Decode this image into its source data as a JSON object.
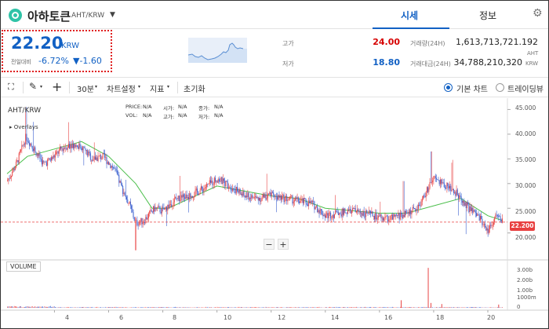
{
  "header": {
    "coin_name": "아하토큰",
    "pair": "AHT/KRW",
    "caret": "▼",
    "tabs": [
      {
        "label": "시세",
        "active": true
      },
      {
        "label": "정보",
        "active": false
      }
    ],
    "settings_icon": "gear-icon"
  },
  "price": {
    "value": "22.20",
    "unit": "KRW",
    "change_label": "전일대비",
    "change_pct": "-6.72%",
    "change_value": "▼-1.60"
  },
  "stats": {
    "high_label": "고가",
    "high": "24.00",
    "low_label": "저가",
    "low": "18.80",
    "volume_label": "거래량(24H)",
    "volume": "1,613,713,721.192",
    "volume_unit": "AHT",
    "amount_label": "거래대금(24H)",
    "amount": "34,788,210,320",
    "amount_unit": "KRW"
  },
  "toolbar": {
    "interval": "30분",
    "chart_settings": "차트설정",
    "indicators": "지표",
    "reset": "초기화",
    "basic_chart": "기본 차트",
    "trading_view": "트레이딩뷰"
  },
  "chart": {
    "pair": "AHT/KRW",
    "overlays": "Overlays",
    "info": {
      "price_label": "PRICE:",
      "price_val": "N/A",
      "open_label": "시가:",
      "open_val": "N/A",
      "close_label": "종가:",
      "close_val": "N/A",
      "vol_label": "VOL:",
      "vol_val": "N/A",
      "high_label": "고가:",
      "high_val": "N/A",
      "low_label": "저가:",
      "low_val": "N/A"
    },
    "volume_label": "VOLUME",
    "current_price_tag": "22.200",
    "zoom_out": "−",
    "zoom_in": "+"
  },
  "chart_data": {
    "type": "candlestick",
    "y_ticks": [
      "45.000",
      "40.000",
      "35.000",
      "30.000",
      "25.000",
      "20.000"
    ],
    "y_tick_values": [
      45,
      40,
      35,
      30,
      25,
      20
    ],
    "ylim": [
      15.5,
      46.5
    ],
    "volume_ticks": [
      "3.00b",
      "2.00b",
      "1.00b",
      "1000m",
      "0"
    ],
    "x_ticks": [
      "4",
      "6",
      "8",
      "10",
      "12",
      "14",
      "16",
      "18",
      "20"
    ],
    "x_tick_days": [
      4,
      6,
      8,
      10,
      12,
      14,
      16,
      18,
      20
    ],
    "xlim_days": [
      2.25,
      20.55
    ],
    "price_path": [
      {
        "day": 2.25,
        "price": 30.5
      },
      {
        "day": 2.6,
        "price": 34
      },
      {
        "day": 2.95,
        "price": 39.5
      },
      {
        "day": 3.25,
        "price": 37
      },
      {
        "day": 3.6,
        "price": 34
      },
      {
        "day": 3.9,
        "price": 35
      },
      {
        "day": 4.25,
        "price": 37
      },
      {
        "day": 4.6,
        "price": 38
      },
      {
        "day": 5.0,
        "price": 37.5
      },
      {
        "day": 5.4,
        "price": 35
      },
      {
        "day": 5.8,
        "price": 35.5
      },
      {
        "day": 6.2,
        "price": 33
      },
      {
        "day": 6.5,
        "price": 29
      },
      {
        "day": 6.75,
        "price": 26
      },
      {
        "day": 7.0,
        "price": 22
      },
      {
        "day": 7.3,
        "price": 22.5
      },
      {
        "day": 7.7,
        "price": 25
      },
      {
        "day": 8.0,
        "price": 24.5
      },
      {
        "day": 8.5,
        "price": 27
      },
      {
        "day": 9.0,
        "price": 27.5
      },
      {
        "day": 9.5,
        "price": 29
      },
      {
        "day": 10.0,
        "price": 31
      },
      {
        "day": 10.5,
        "price": 29.5
      },
      {
        "day": 11.0,
        "price": 27.5
      },
      {
        "day": 11.5,
        "price": 27
      },
      {
        "day": 12.0,
        "price": 27.5
      },
      {
        "day": 12.5,
        "price": 27
      },
      {
        "day": 13.0,
        "price": 26.5
      },
      {
        "day": 13.5,
        "price": 26
      },
      {
        "day": 14.0,
        "price": 23.5
      },
      {
        "day": 14.5,
        "price": 24
      },
      {
        "day": 15.0,
        "price": 24.5
      },
      {
        "day": 15.5,
        "price": 24
      },
      {
        "day": 16.0,
        "price": 23
      },
      {
        "day": 16.5,
        "price": 23
      },
      {
        "day": 17.0,
        "price": 24
      },
      {
        "day": 17.4,
        "price": 25
      },
      {
        "day": 17.7,
        "price": 28
      },
      {
        "day": 18.0,
        "price": 31
      },
      {
        "day": 18.3,
        "price": 30
      },
      {
        "day": 18.7,
        "price": 29
      },
      {
        "day": 19.0,
        "price": 27
      },
      {
        "day": 19.3,
        "price": 25
      },
      {
        "day": 19.7,
        "price": 23
      },
      {
        "day": 20.0,
        "price": 20.5
      },
      {
        "day": 20.3,
        "price": 23.5
      },
      {
        "day": 20.55,
        "price": 22.2
      }
    ],
    "ma_path": [
      {
        "day": 2.25,
        "price": 32
      },
      {
        "day": 3.0,
        "price": 35.5
      },
      {
        "day": 4.0,
        "price": 37
      },
      {
        "day": 5.0,
        "price": 38.5
      },
      {
        "day": 6.0,
        "price": 35.5
      },
      {
        "day": 7.0,
        "price": 30
      },
      {
        "day": 7.6,
        "price": 25
      },
      {
        "day": 8.2,
        "price": 25
      },
      {
        "day": 9.0,
        "price": 27
      },
      {
        "day": 10.0,
        "price": 29.5
      },
      {
        "day": 11.0,
        "price": 28.5
      },
      {
        "day": 12.0,
        "price": 27.5
      },
      {
        "day": 13.0,
        "price": 27
      },
      {
        "day": 14.0,
        "price": 25
      },
      {
        "day": 15.0,
        "price": 24.5
      },
      {
        "day": 16.0,
        "price": 24
      },
      {
        "day": 17.0,
        "price": 24
      },
      {
        "day": 18.0,
        "price": 25.5
      },
      {
        "day": 19.0,
        "price": 27
      },
      {
        "day": 20.0,
        "price": 23.5
      },
      {
        "day": 20.55,
        "price": 22.5
      }
    ],
    "volume_spikes_b": [
      {
        "day": 17.8,
        "volume": 3.7
      },
      {
        "day": 16.8,
        "volume": 0.7
      },
      {
        "day": 17.9,
        "volume": 0.45
      },
      {
        "day": 18.3,
        "volume": 0.35
      },
      {
        "day": 20.4,
        "volume": 0.3
      }
    ],
    "current_price": 22.2
  }
}
